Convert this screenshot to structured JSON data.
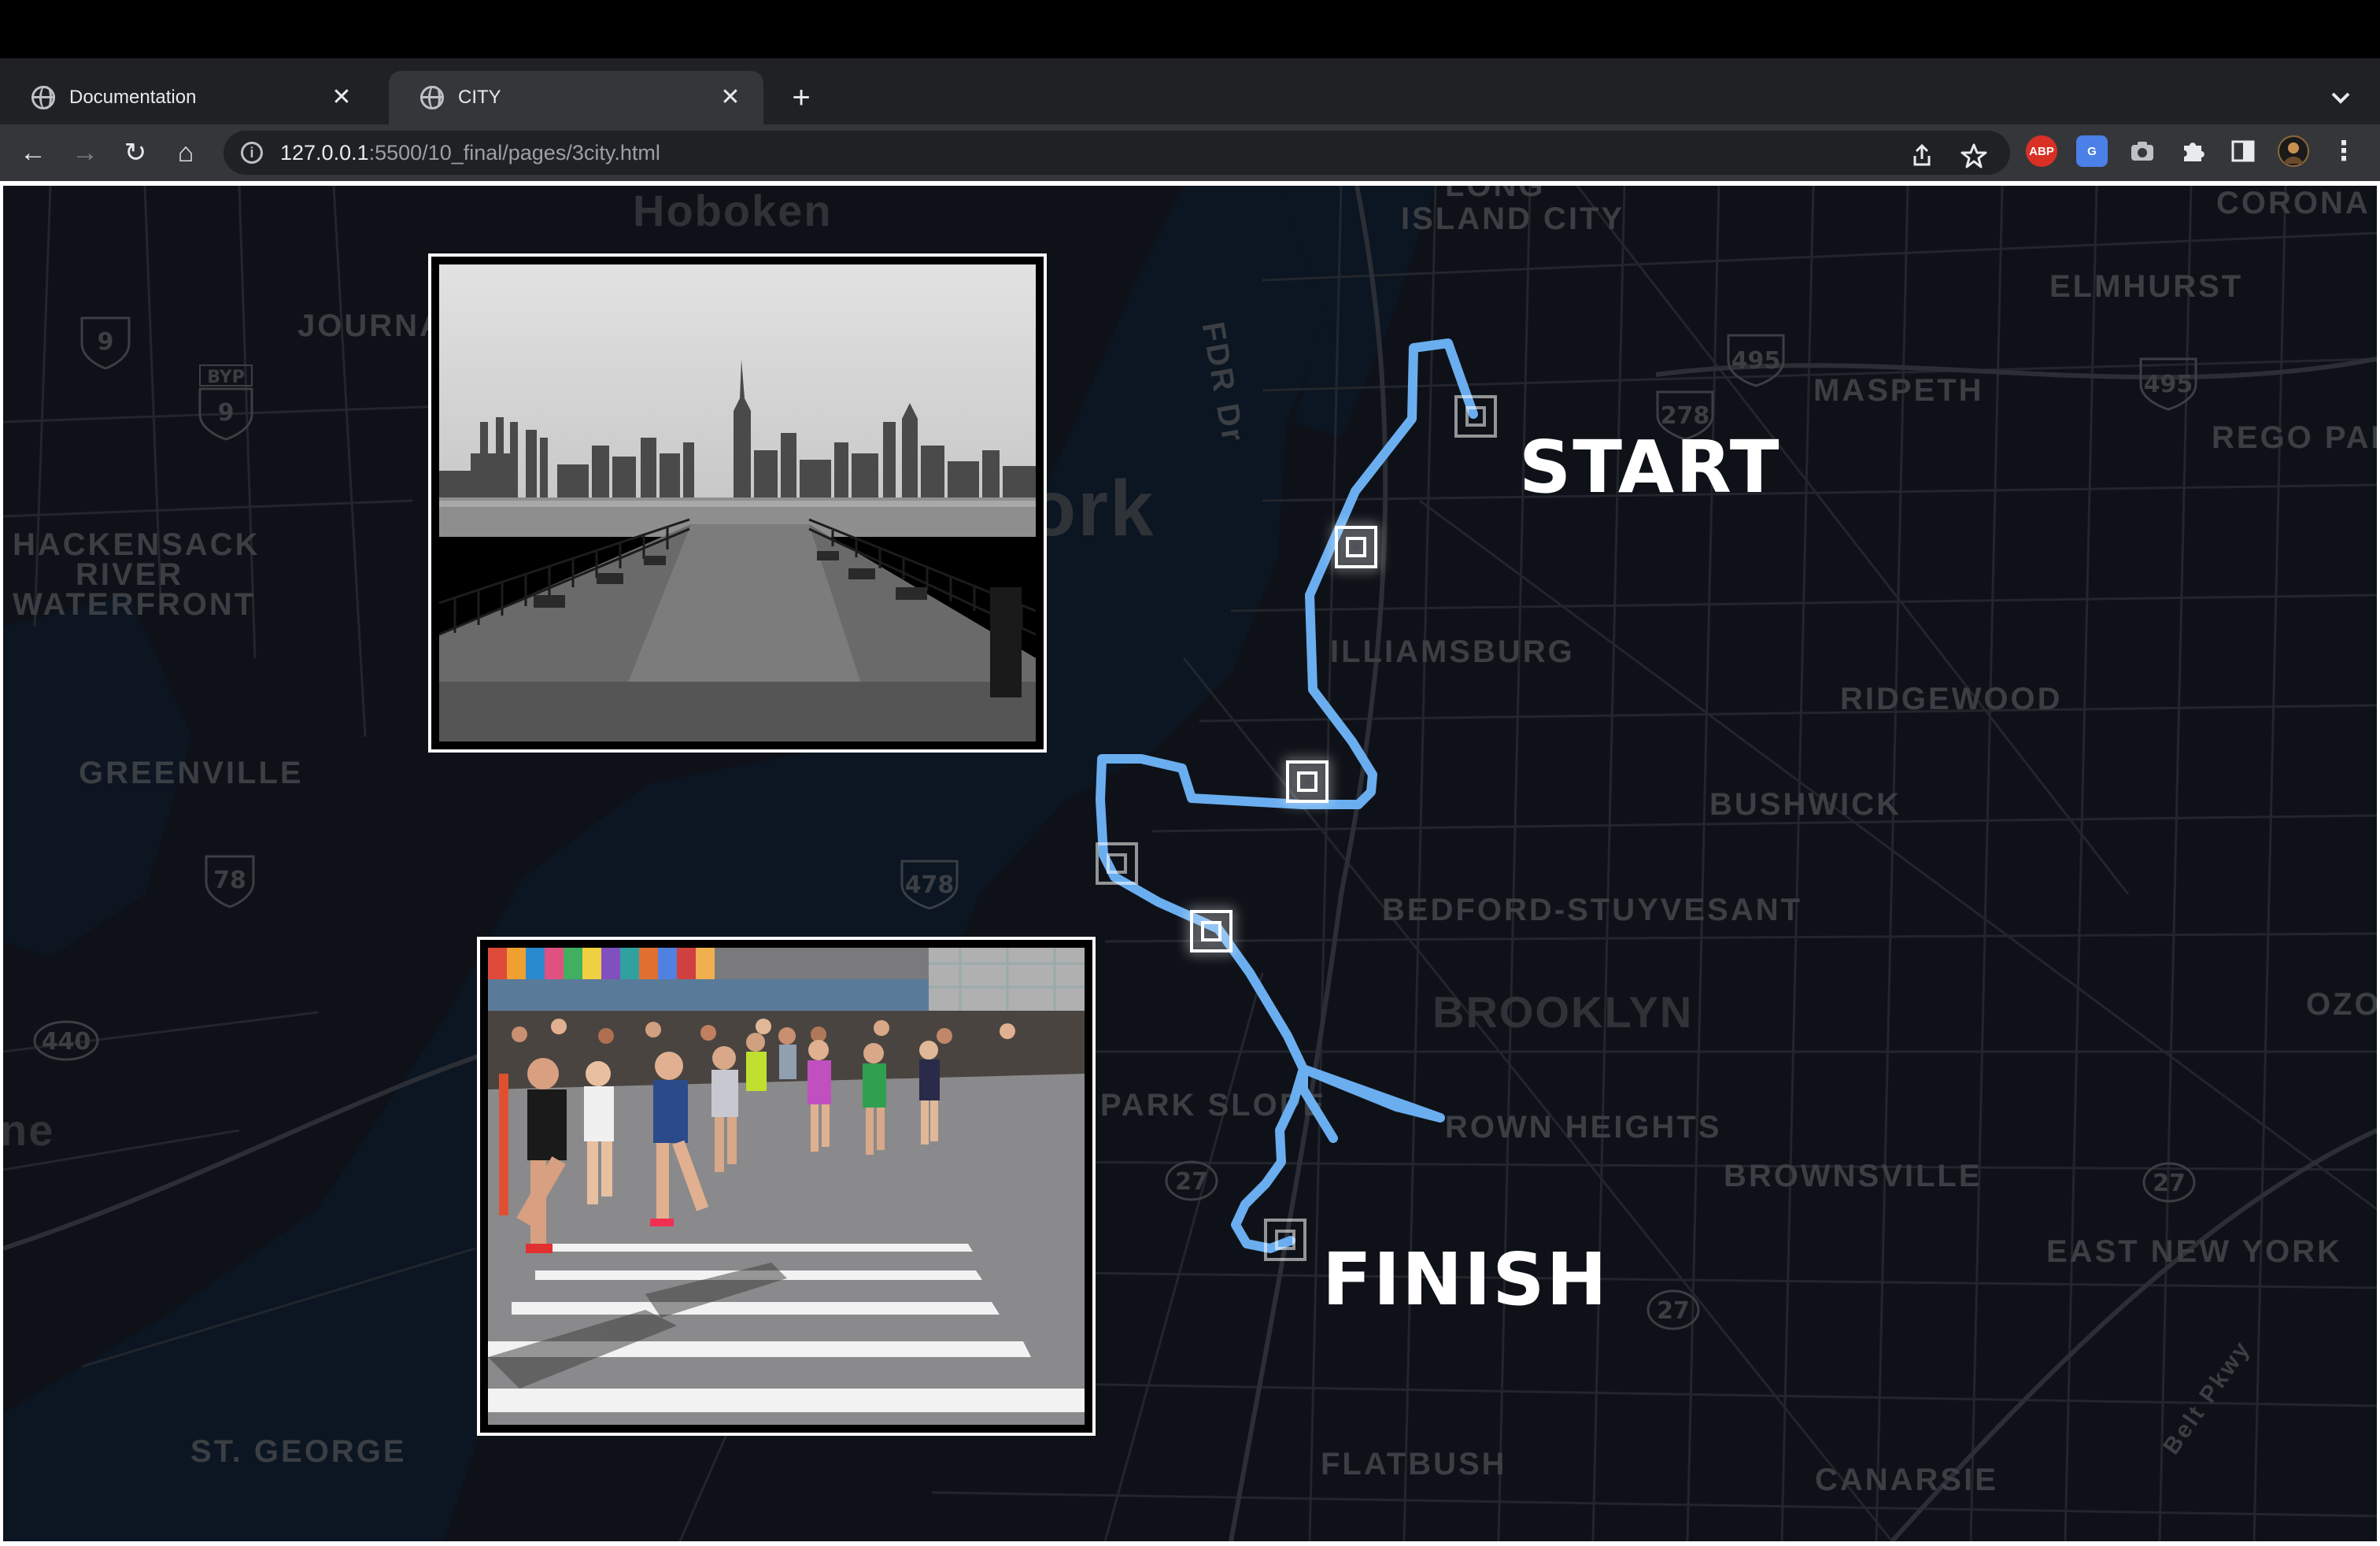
{
  "browser": {
    "tabs": [
      {
        "title": "Documentation",
        "active": false
      },
      {
        "title": "CITY",
        "active": true
      }
    ],
    "new_tab_symbol": "+",
    "tab_menu_symbol": "⌄",
    "close_symbol": "✕",
    "url_host": "127.0.0.1",
    "url_path": ":5500/10_final/pages/3city.html",
    "nav": {
      "back": "←",
      "forward": "→",
      "reload": "↻",
      "home": "⌂"
    },
    "toolbar_icons": [
      "share-icon",
      "bookmark-star-icon",
      "adblock-icon",
      "translate-icon",
      "camera-icon",
      "extensions-puzzle-icon",
      "side-panel-icon",
      "profile-avatar",
      "menu-kebab-icon"
    ],
    "ext_abp_text": "ABP",
    "ext_translate_text": "G",
    "star_symbol": "☆",
    "share_symbol": "⇧",
    "menu_symbol": "⋮",
    "puzzle_symbol": "✚"
  },
  "map": {
    "colors": {
      "background": "#0e1218",
      "water": "#0b1622",
      "roads": "#262a30",
      "label": "#3b3f44",
      "route": "#6aaef0"
    },
    "labels": [
      {
        "text": "Hoboken",
        "kind": "big"
      },
      {
        "text": "LONG",
        "kind": "med"
      },
      {
        "text": "ISLAND CITY",
        "kind": "med"
      },
      {
        "text": "CORONA",
        "kind": "med"
      },
      {
        "text": "ELMHURST",
        "kind": "med"
      },
      {
        "text": "JOURNA",
        "kind": "med"
      },
      {
        "text": "MASPETH",
        "kind": "med"
      },
      {
        "text": "REGO PARK",
        "kind": "med"
      },
      {
        "text": "HACKENSACK",
        "kind": "med"
      },
      {
        "text": "RIVER",
        "kind": "med"
      },
      {
        "text": "WATERFRONT",
        "kind": "med"
      },
      {
        "text": "ILLIAMSBURG",
        "kind": "med"
      },
      {
        "text": "RIDGEWOOD",
        "kind": "med"
      },
      {
        "text": "GREENVILLE",
        "kind": "med"
      },
      {
        "text": "BUSHWICK",
        "kind": "med"
      },
      {
        "text": "BEDFORD-STUYVESANT",
        "kind": "med"
      },
      {
        "text": "BROOKLYN",
        "kind": "big"
      },
      {
        "text": "PARK SLOPE",
        "kind": "med"
      },
      {
        "text": "ROWN HEIGHTS",
        "kind": "med"
      },
      {
        "text": "BROWNSVILLE",
        "kind": "med"
      },
      {
        "text": "EAST NEW YORK",
        "kind": "med"
      },
      {
        "text": "ST. GEORGE",
        "kind": "med"
      },
      {
        "text": "FLATBUSH",
        "kind": "med"
      },
      {
        "text": "CANARSIE",
        "kind": "med"
      },
      {
        "text": "OZO",
        "kind": "med"
      },
      {
        "text": "FDR Dr",
        "kind": "med"
      },
      {
        "text": "ork",
        "kind": "big"
      },
      {
        "text": "ne",
        "kind": "big"
      },
      {
        "text": "Belt Pkwy",
        "kind": "med"
      }
    ],
    "shields": [
      "9",
      "9",
      "495",
      "495",
      "278",
      "78",
      "478",
      "440",
      "27",
      "27",
      "27"
    ],
    "shield_byp": "BYP",
    "route": {
      "start_label": "START",
      "finish_label": "FINISH"
    }
  },
  "photos": [
    {
      "name": "waterfront-pier-photo",
      "desc_color": "grayscale"
    },
    {
      "name": "marathon-runners-photo",
      "desc_color": "color"
    }
  ]
}
